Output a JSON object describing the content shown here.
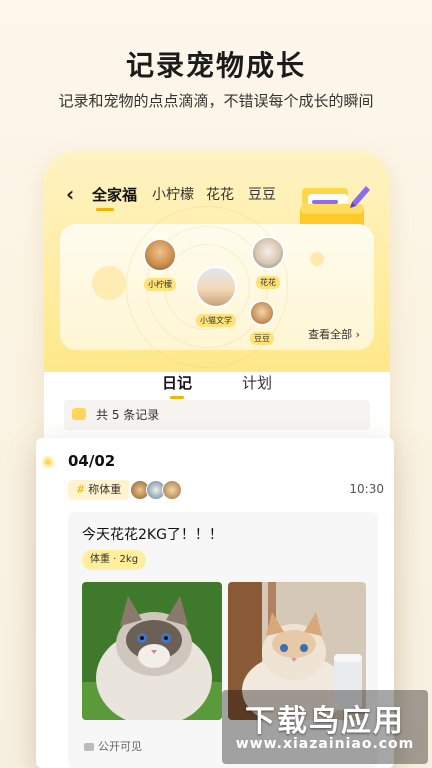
{
  "hero": {
    "title": "记录宠物成长",
    "subtitle": "记录和宠物的点点滴滴，不错误每个成长的瞬间"
  },
  "topbar": {
    "tabs": [
      "全家福",
      "小柠檬",
      "花花",
      "豆豆"
    ],
    "active_tab": "全家福"
  },
  "family": {
    "members": [
      "小柠檬",
      "花花",
      "小猫文学",
      "豆豆"
    ],
    "view_all": "查看全部 ›"
  },
  "diary_tabs": {
    "diary": "日记",
    "plan": "计划"
  },
  "records_count": "共 5 条记录",
  "record": {
    "date": "04/02",
    "tag": "称体重",
    "time": "10:30",
    "title": "今天花花2KG了！！！",
    "weight_badge": "体重 · 2kg",
    "privacy": "公开可见"
  },
  "watermark": {
    "main": "下载鸟应用",
    "sub": "www.xiazainiao.com"
  },
  "colors": {
    "accent": "#f3b400",
    "panel": "#ffe88a",
    "tag_bg": "#fff4cf"
  }
}
